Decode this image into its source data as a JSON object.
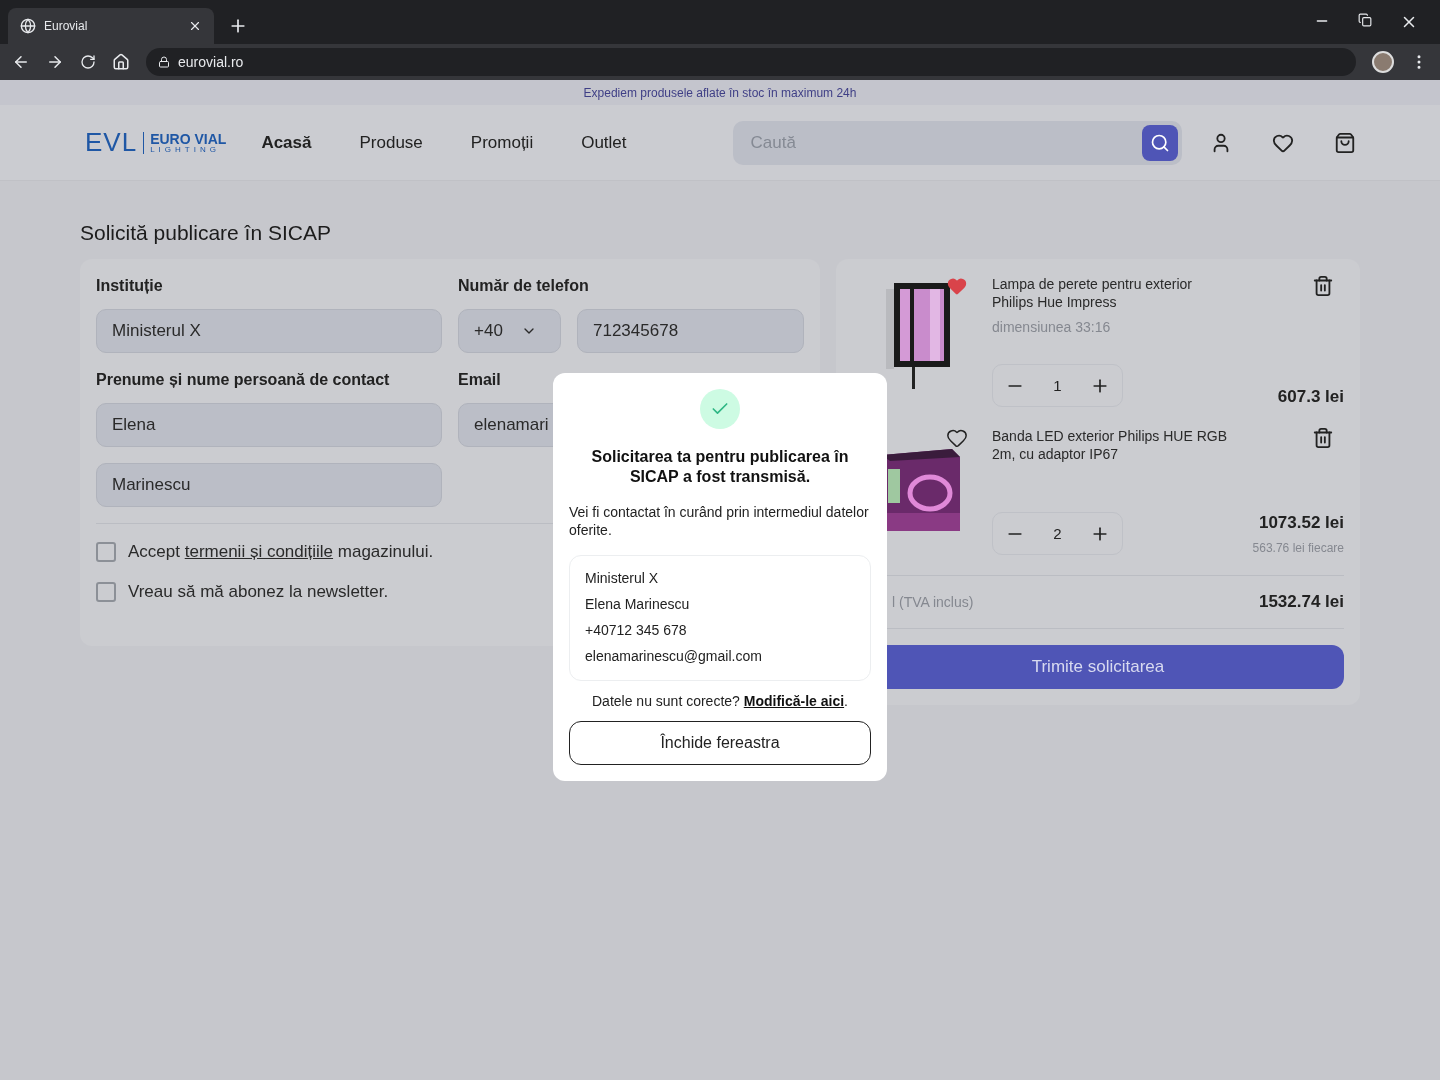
{
  "browser": {
    "tab_title": "Eurovial",
    "url": "eurovial.ro"
  },
  "banner": "Expediem produsele aflate în stoc în maximum 24h",
  "nav": {
    "logo": {
      "mark": "EVL",
      "name": "EURO VIAL",
      "sub": "LIGHTING"
    },
    "links": [
      {
        "label": "Acasă",
        "selected": true
      },
      {
        "label": "Produse",
        "selected": false
      },
      {
        "label": "Promoții",
        "selected": false
      },
      {
        "label": "Outlet",
        "selected": false
      }
    ],
    "search_placeholder": "Caută"
  },
  "page_title": "Solicită publicare în SICAP",
  "form": {
    "institution": {
      "label": "Instituție",
      "value": "Ministerul X"
    },
    "phone": {
      "label": "Număr de telefon",
      "prefix": "+40",
      "number": "712345678"
    },
    "contact": {
      "label": "Prenume și nume persoană de contact",
      "first_name": "Elena",
      "last_name": "Marinescu"
    },
    "email": {
      "label": "Email",
      "value": "elenamari"
    },
    "checkboxes": [
      {
        "before": "Accept ",
        "link": "termenii și condițiile",
        "after": " magazinului.",
        "checked": false
      },
      {
        "before": "Vreau să mă abonez la newsletter.",
        "checked": false
      }
    ]
  },
  "cart": {
    "items": [
      {
        "name": "Lampa de perete pentru exterior Philips Hue Impress",
        "variant": "dimensiunea 33:16",
        "quantity": "1",
        "price": "607.3 lei",
        "favorite": true,
        "kind": "lamp"
      },
      {
        "name": "Banda LED exterior Philips HUE RGB 2m, cu adaptor IP67",
        "quantity": "2",
        "price": "1073.52 lei",
        "unit_price": "563.76 lei fiecare",
        "favorite": false,
        "kind": "strip"
      }
    ],
    "total_label": "l (TVA inclus)",
    "total": "1532.74 lei",
    "submit": "Trimite solicitarea"
  },
  "modal": {
    "title": "Solicitarea ta pentru publicarea în SICAP a fost transmisă.",
    "message": "Vei fi contactat în curând prin intermediul datelor oferite.",
    "details": [
      "Ministerul X",
      "Elena Marinescu",
      "+40712 345 678",
      "elenamarinescu@gmail.com"
    ],
    "note": "Datele nu sunt corecte? ",
    "note_link": "Modifică-le aici",
    "note_end": ".",
    "close_button": "Închide fereastra"
  }
}
